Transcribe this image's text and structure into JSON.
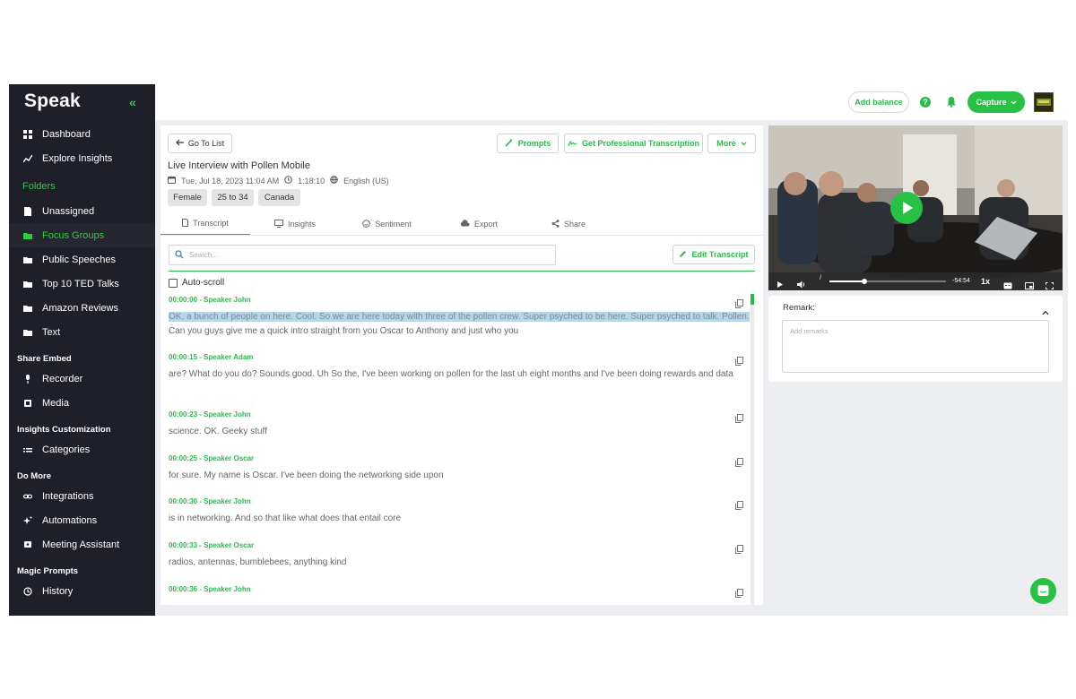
{
  "app": {
    "logo": "Speak"
  },
  "sidebar": {
    "top_items": [
      {
        "label": "Dashboard",
        "icon": "dashboard-icon"
      },
      {
        "label": "Explore Insights",
        "icon": "insights-icon"
      }
    ],
    "folders_label": "Folders",
    "folders": [
      {
        "label": "Unassigned",
        "icon": "file-icon"
      },
      {
        "label": "Focus Groups",
        "icon": "folder-icon",
        "active": true
      },
      {
        "label": "Public Speeches",
        "icon": "folder-icon"
      },
      {
        "label": "Top 10 TED Talks",
        "icon": "folder-icon"
      },
      {
        "label": "Amazon Reviews",
        "icon": "folder-icon"
      },
      {
        "label": "Text",
        "icon": "folder-icon"
      }
    ],
    "share_embed_label": "Share Embed",
    "share_embed": [
      {
        "label": "Recorder",
        "icon": "microphone-icon"
      },
      {
        "label": "Media",
        "icon": "media-icon"
      }
    ],
    "insights_custom_label": "Insights Customization",
    "insights_custom": [
      {
        "label": "Categories",
        "icon": "list-icon"
      }
    ],
    "do_more_label": "Do More",
    "do_more": [
      {
        "label": "Integrations",
        "icon": "link-icon"
      },
      {
        "label": "Automations",
        "icon": "sparkle-icon"
      },
      {
        "label": "Meeting Assistant",
        "icon": "assistant-icon"
      }
    ],
    "magic_prompts_label": "Magic Prompts",
    "magic_prompts": [
      {
        "label": "History",
        "icon": "history-icon"
      }
    ]
  },
  "topbar": {
    "add_balance": "Add balance",
    "capture": "Capture"
  },
  "toolbar": {
    "go_to_list": "Go To List",
    "prompts": "Prompts",
    "get_pro": "Get Professional Transcription",
    "more": "More"
  },
  "document": {
    "title": "Live Interview with Pollen Mobile",
    "date": "Tue, Jul 18, 2023 11:04 AM",
    "duration": "1:18:10",
    "language": "English (US)",
    "tags": [
      "Female",
      "25 to 34",
      "Canada"
    ]
  },
  "tabs": [
    "Transcript",
    "Insights",
    "Sentiment",
    "Export",
    "Share"
  ],
  "search": {
    "placeholder": "Search..."
  },
  "edit_transcript": "Edit Transcript",
  "autoscroll": "Auto-scroll",
  "segments": [
    {
      "head": "00:00:00 - Speaker John",
      "highlight": "OK, a bunch of people on here. Cool. So we are here today with three of the pollen crew. Super psyched to be here. Super psyched to talk. Pollen.",
      "text": " Can you guys give me a quick intro straight from you Oscar to Anthony and just who you"
    },
    {
      "head": "00:00:15 - Speaker Adam",
      "highlight": "",
      "text": "are? What do you do? Sounds good. Uh So the, I've been working on pollen for the last uh eight months and I've been doing rewards and data"
    },
    {
      "head": "00:00:23 - Speaker John",
      "highlight": "",
      "text": "science. OK. Geeky stuff"
    },
    {
      "head": "00:00:25 - Speaker Oscar",
      "highlight": "",
      "text": "for sure. My name is Oscar. I've been doing the networking side upon"
    },
    {
      "head": "00:00:30 - Speaker John",
      "highlight": "",
      "text": "is in networking. And so that like what does that entail core"
    },
    {
      "head": "00:00:33 - Speaker Oscar",
      "highlight": "",
      "text": "radios, antennas, bumblebees, anything kind"
    },
    {
      "head": "00:00:36 - Speaker John",
      "highlight": "",
      "text": ""
    }
  ],
  "video": {
    "time_remaining": "-54:54",
    "speed": "1x",
    "progress": 0.3
  },
  "remark": {
    "title": "Remark:",
    "placeholder": "Add remarks"
  },
  "colors": {
    "brand": "#2db84a",
    "sidebar": "#1e1f29",
    "highlight": "#b6d7e8"
  }
}
